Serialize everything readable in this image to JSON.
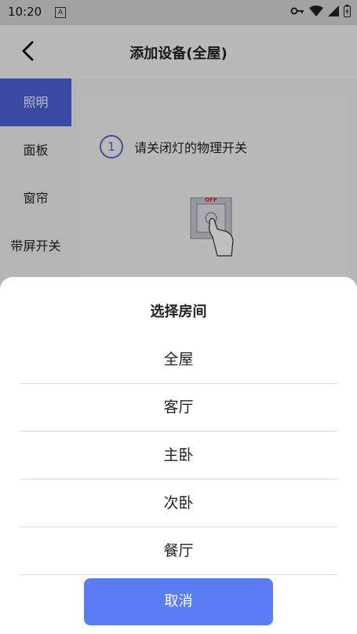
{
  "status_bar": {
    "time": "10:20",
    "notif_letter": "A"
  },
  "header": {
    "title": "添加设备(全屋)"
  },
  "sidebar": {
    "items": [
      {
        "label": "照明",
        "active": true
      },
      {
        "label": "面板",
        "active": false
      },
      {
        "label": "窗帘",
        "active": false
      },
      {
        "label": "带屏开关",
        "active": false
      }
    ]
  },
  "main": {
    "step_number": "1",
    "step_text": "请关闭灯的物理开关",
    "switch_label": "OFF"
  },
  "sheet": {
    "title": "选择房间",
    "options": [
      "全屋",
      "客厅",
      "主卧",
      "次卧",
      "餐厅"
    ],
    "cancel_label": "取消"
  },
  "colors": {
    "accent": "#4d61d6",
    "button": "#5c7cf6"
  }
}
